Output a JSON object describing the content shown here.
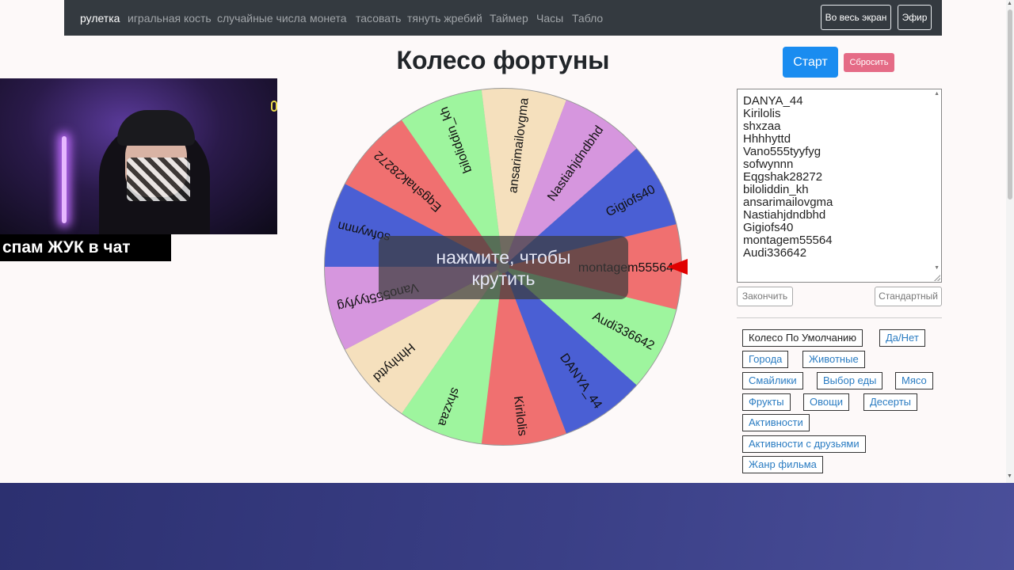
{
  "nav": {
    "links": [
      "рулетка",
      "игральная кость",
      "случайные числа",
      "монета",
      "тасовать",
      "тянуть жребий",
      "Таймер",
      "Часы",
      "Табло"
    ],
    "fullscreen": "Во весь экран",
    "live": "Эфир"
  },
  "title": "Колесо фортуны",
  "buttons": {
    "start": "Старт",
    "reset": "Сбросить",
    "finish": "Закончить",
    "standard": "Стандартный"
  },
  "overlay": "спам ЖУК в чат",
  "spin_prompt": [
    "нажмите, чтобы",
    "крутить"
  ],
  "entries": [
    "DANYA_44",
    "Kirilolis",
    "shxzaa",
    "Hhhhyttd",
    "Vano555tyyfyg",
    "sofwynnn",
    "Eqgshak28272",
    "biloliddin_kh",
    "ansarimailovgma",
    "Nastiahjdndbhd",
    "Gigiofs40",
    "montagem55564",
    "Audi336642"
  ],
  "wheel": {
    "pointer_color": "#e00000",
    "segments": [
      {
        "label": "montagem55564",
        "color": "#f07070"
      },
      {
        "label": "Audi336642",
        "color": "#9ef59e"
      },
      {
        "label": "DANYA_44",
        "color": "#4a5fd4"
      },
      {
        "label": "Kirilolis",
        "color": "#f07070"
      },
      {
        "label": "shxzaa",
        "color": "#9ef59e"
      },
      {
        "label": "Hhhhyttd",
        "color": "#f5e0bd"
      },
      {
        "label": "Vano555tyyfyg",
        "color": "#d696de"
      },
      {
        "label": "sofwynnn",
        "color": "#4a5fd4"
      },
      {
        "label": "Eqgshak28272",
        "color": "#f07070"
      },
      {
        "label": "biloliddin_kh",
        "color": "#9ef59e"
      },
      {
        "label": "ansarimailovgma",
        "color": "#f5e0bd"
      },
      {
        "label": "Nastiahjdndbhd",
        "color": "#d696de"
      },
      {
        "label": "Gigiofs40",
        "color": "#4a5fd4"
      }
    ]
  },
  "presets": [
    {
      "label": "Колесо По Умолчанию",
      "dark": true
    },
    {
      "label": "Да/Нет"
    },
    {
      "label": "Города"
    },
    {
      "label": "Животные"
    },
    {
      "label": "Смайлики"
    },
    {
      "label": "Выбор еды"
    },
    {
      "label": "Мясо"
    },
    {
      "label": "Фрукты"
    },
    {
      "label": "Овощи"
    },
    {
      "label": "Десерты"
    },
    {
      "label": "Активности"
    },
    {
      "label": "Активности с друзьями"
    },
    {
      "label": "Жанр фильма"
    }
  ]
}
